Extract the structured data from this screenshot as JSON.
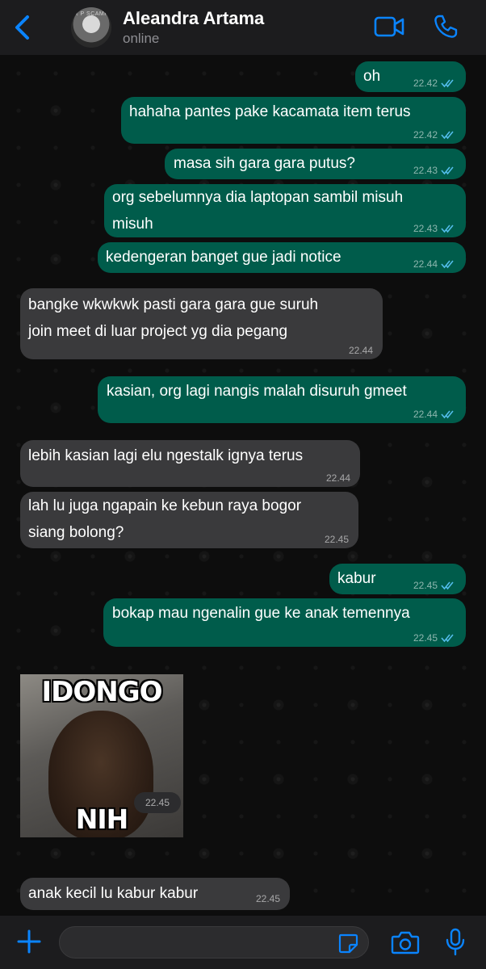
{
  "header": {
    "back_label": "",
    "contact_name": "Aleandra Artama",
    "status": "online",
    "avatar_text": "R P SCAMP"
  },
  "messages": [
    {
      "dir": "out",
      "text": "oh",
      "time": "22.42",
      "read": true
    },
    {
      "dir": "out",
      "text": "hahaha pantes pake kacamata item terus",
      "time": "22.42",
      "read": true
    },
    {
      "dir": "out",
      "text": "masa sih gara gara putus?",
      "time": "22.43",
      "read": true
    },
    {
      "dir": "out",
      "text": "org sebelumnya dia laptopan sambil misuh\nmisuh",
      "time": "22.43",
      "read": true
    },
    {
      "dir": "out",
      "text": "kedengeran banget gue jadi notice",
      "time": "22.44",
      "read": true
    },
    {
      "dir": "in",
      "text": "bangke wkwkwk pasti gara gara gue suruh\njoin meet di luar project yg dia pegang",
      "time": "22.44"
    },
    {
      "dir": "out",
      "text": "kasian, org lagi nangis malah disuruh gmeet",
      "time": "22.44",
      "read": true
    },
    {
      "dir": "in",
      "text": "lebih kasian lagi elu ngestalk ignya terus",
      "time": "22.44"
    },
    {
      "dir": "in",
      "text": "lah lu juga ngapain ke kebun raya bogor\nsiang bolong?",
      "time": "22.45"
    },
    {
      "dir": "out",
      "text": "kabur",
      "time": "22.45",
      "read": true
    },
    {
      "dir": "out",
      "text": "bokap mau ngenalin gue ke anak temennya",
      "time": "22.45",
      "read": true
    },
    {
      "dir": "in",
      "text": "anak kecil lu kabur kabur",
      "time": "22.45"
    }
  ],
  "sticker": {
    "top_text": "IDONGO",
    "bottom_text": "NIH ORANG",
    "time": "22.45"
  },
  "colors": {
    "outgoing_bubble": "#005c4b",
    "incoming_bubble": "#3a3a3c",
    "accent": "#0a84ff",
    "read_ticks": "#53bdeb"
  },
  "input": {
    "placeholder": "",
    "value": ""
  },
  "icons": {
    "back": "chevron-left-icon",
    "video": "video-camera-icon",
    "phone": "phone-icon",
    "plus": "plus-icon",
    "sticker": "sticker-icon",
    "camera": "camera-icon",
    "mic": "microphone-icon"
  }
}
